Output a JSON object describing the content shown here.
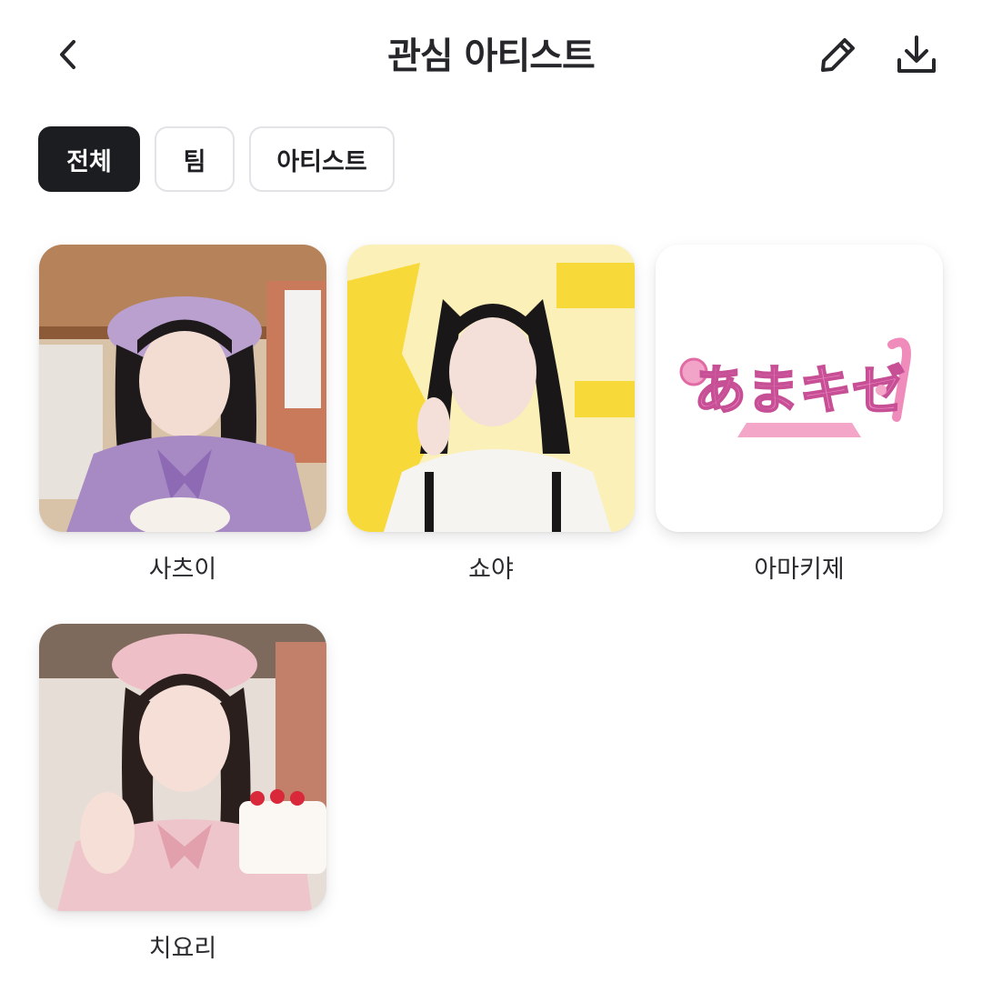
{
  "header": {
    "title": "관심 아티스트",
    "back_icon": "chevron-left-icon",
    "edit_icon": "pencil-icon",
    "download_icon": "download-icon"
  },
  "filters": {
    "tabs": [
      {
        "label": "전체",
        "active": true
      },
      {
        "label": "팀",
        "active": false
      },
      {
        "label": "아티스트",
        "active": false
      }
    ]
  },
  "artists": [
    {
      "name": "사츠이"
    },
    {
      "name": "쇼야"
    },
    {
      "name": "아마키제",
      "logo_text": "あまキゼ"
    },
    {
      "name": "치요리"
    }
  ],
  "colors": {
    "active_chip_bg": "#1c1d21",
    "chip_border": "#e2e3e6",
    "text_primary": "#26272b"
  }
}
